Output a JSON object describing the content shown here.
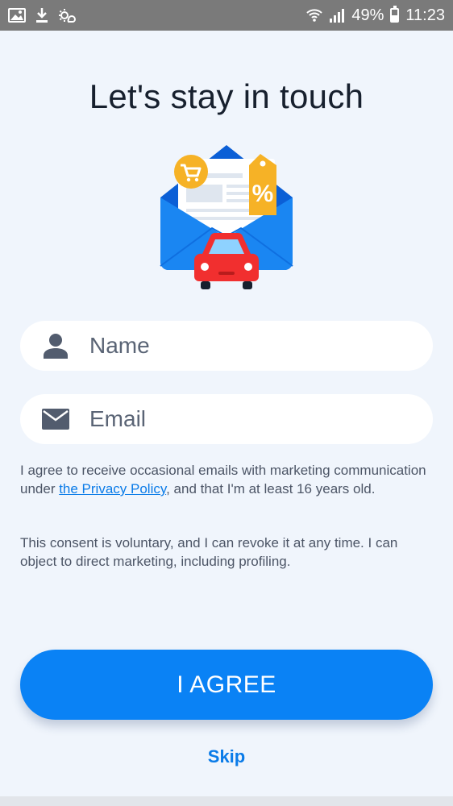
{
  "status_bar": {
    "battery": "49%",
    "time": "11:23",
    "icons": [
      "image-icon",
      "download-icon",
      "weather-icon",
      "wifi-icon",
      "signal-icon",
      "battery-icon"
    ]
  },
  "title": "Let's stay in touch",
  "illustration": {
    "icons": [
      "envelope-icon",
      "cart-icon",
      "discount-tag-icon",
      "car-icon"
    ],
    "tag_text": "%"
  },
  "form": {
    "name_placeholder": "Name",
    "email_placeholder": "Email"
  },
  "consent": {
    "part1": "I agree to receive occasional emails with marketing communication under ",
    "link": "the Privacy Policy",
    "part2": ", and that I'm at least 16 years old.",
    "paragraph2": "This consent is voluntary, and I can revoke it at any time. I can object to direct marketing, including profiling."
  },
  "buttons": {
    "agree": "I AGREE",
    "skip": "Skip"
  },
  "colors": {
    "accent": "#0a82f5",
    "link": "#0a7be8",
    "background": "#f0f5fc",
    "title": "#17202e"
  }
}
